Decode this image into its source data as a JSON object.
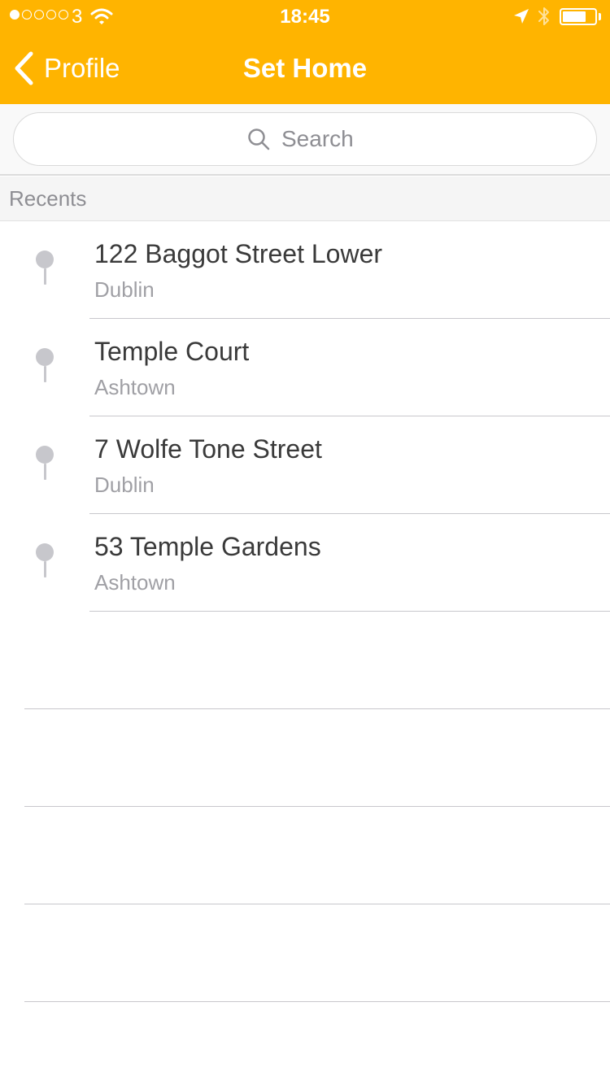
{
  "status_bar": {
    "carrier": "3",
    "time": "18:45",
    "signal_bars_filled": 1,
    "signal_bars_total": 5,
    "battery_level": 0.75
  },
  "nav": {
    "back_label": "Profile",
    "title": "Set Home"
  },
  "search": {
    "placeholder": "Search"
  },
  "section": {
    "title": "Recents"
  },
  "recents": [
    {
      "title": "122 Baggot Street Lower",
      "subtitle": "Dublin"
    },
    {
      "title": "Temple Court",
      "subtitle": "Ashtown"
    },
    {
      "title": "7 Wolfe Tone Street",
      "subtitle": "Dublin"
    },
    {
      "title": "53 Temple Gardens",
      "subtitle": "Ashtown"
    }
  ],
  "colors": {
    "header": "#FFB400",
    "pin": "#C7C7CC",
    "title_text": "#3A3A3A",
    "subtitle_text": "#A0A0A5"
  },
  "icons": {
    "back": "chevron-left-icon",
    "search": "magnifier-icon",
    "pin": "map-pin-icon",
    "location": "location-arrow-icon",
    "bluetooth": "bluetooth-icon",
    "wifi": "wifi-icon",
    "battery": "battery-icon"
  }
}
